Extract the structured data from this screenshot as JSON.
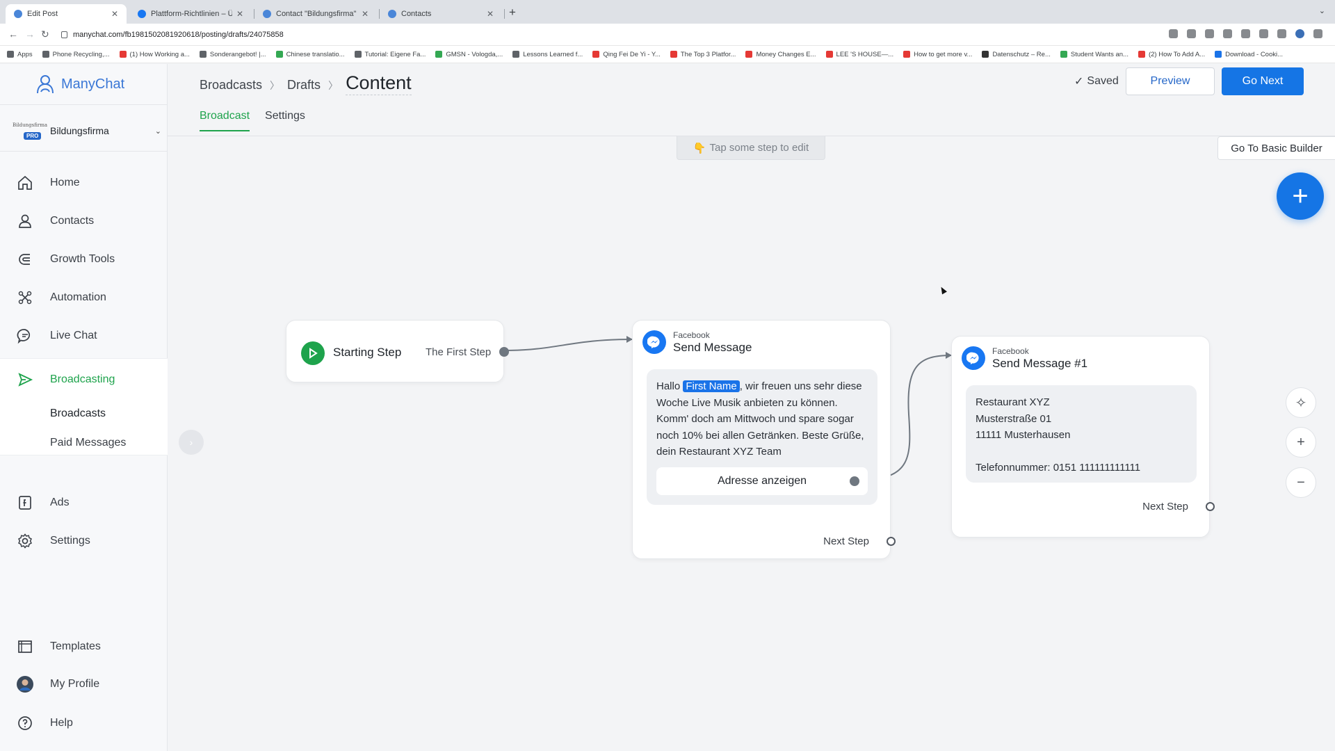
{
  "browser": {
    "tabs": [
      {
        "title": "Edit Post",
        "active": true
      },
      {
        "title": "Plattform-Richtlinien – Übersic",
        "active": false
      },
      {
        "title": "Contact \"Bildungsfirma\" throu",
        "active": false
      },
      {
        "title": "Contacts",
        "active": false
      }
    ],
    "url": "manychat.com/fb198150208192061​8/posting/drafts/24075858",
    "bookmarks": [
      "Apps",
      "Phone Recycling,...",
      "(1) How Working a...",
      "Sonderangebot! |...",
      "Chinese translatio...",
      "Tutorial: Eigene Fa...",
      "GMSN - Vologda,...",
      "Lessons Learned f...",
      "Qing Fei De Yi - Y...",
      "The Top 3 Platfor...",
      "Money Changes E...",
      "LEE 'S HOUSE—...",
      "How to get more v...",
      "Datenschutz – Re...",
      "Student Wants an...",
      "(2) How To Add A...",
      "Download - Cooki..."
    ]
  },
  "app": {
    "brand": "ManyChat",
    "account": {
      "name": "Bildungsfirma",
      "badge": "PRO",
      "logo_text": "Bildungsfirma"
    },
    "nav": {
      "home": "Home",
      "contacts": "Contacts",
      "growth_tools": "Growth Tools",
      "automation": "Automation",
      "live_chat": "Live Chat",
      "broadcasting": "Broadcasting",
      "broadcasts": "Broadcasts",
      "paid_messages": "Paid Messages",
      "ads": "Ads",
      "settings": "Settings",
      "templates": "Templates",
      "my_profile": "My Profile",
      "help": "Help"
    }
  },
  "header": {
    "breadcrumb": [
      "Broadcasts",
      "Drafts"
    ],
    "current": "Content",
    "saved": "Saved",
    "preview": "Preview",
    "go_next": "Go Next",
    "tabs": [
      "Broadcast",
      "Settings"
    ]
  },
  "canvas": {
    "hint": "Tap some step to edit",
    "basic_builder": "Go To Basic Builder",
    "start": {
      "title": "Starting Step",
      "step": "The First Step"
    },
    "message1": {
      "channel": "Facebook",
      "title": "Send Message",
      "text_before": "Hallo ",
      "chip": "First Name",
      "text_after": ", wir freuen uns sehr diese Woche Live Musik anbieten zu können. Komm' doch am Mittwoch und spare sogar noch 10% bei allen Getränken. Beste Grüße, dein Restaurant XYZ Team",
      "button": "Adresse anzeigen",
      "next_step": "Next Step"
    },
    "message2": {
      "channel": "Facebook",
      "title": "Send Message #1",
      "lines": [
        "Restaurant XYZ",
        "Musterstraße 01",
        "11111 Musterhausen",
        "",
        "Telefonnummer: 0151 111111111111"
      ],
      "next_step": "Next Step"
    }
  },
  "colors": {
    "accent_green": "#1ea34c",
    "primary_blue": "#1575e5",
    "facebook_blue": "#1877f2"
  }
}
